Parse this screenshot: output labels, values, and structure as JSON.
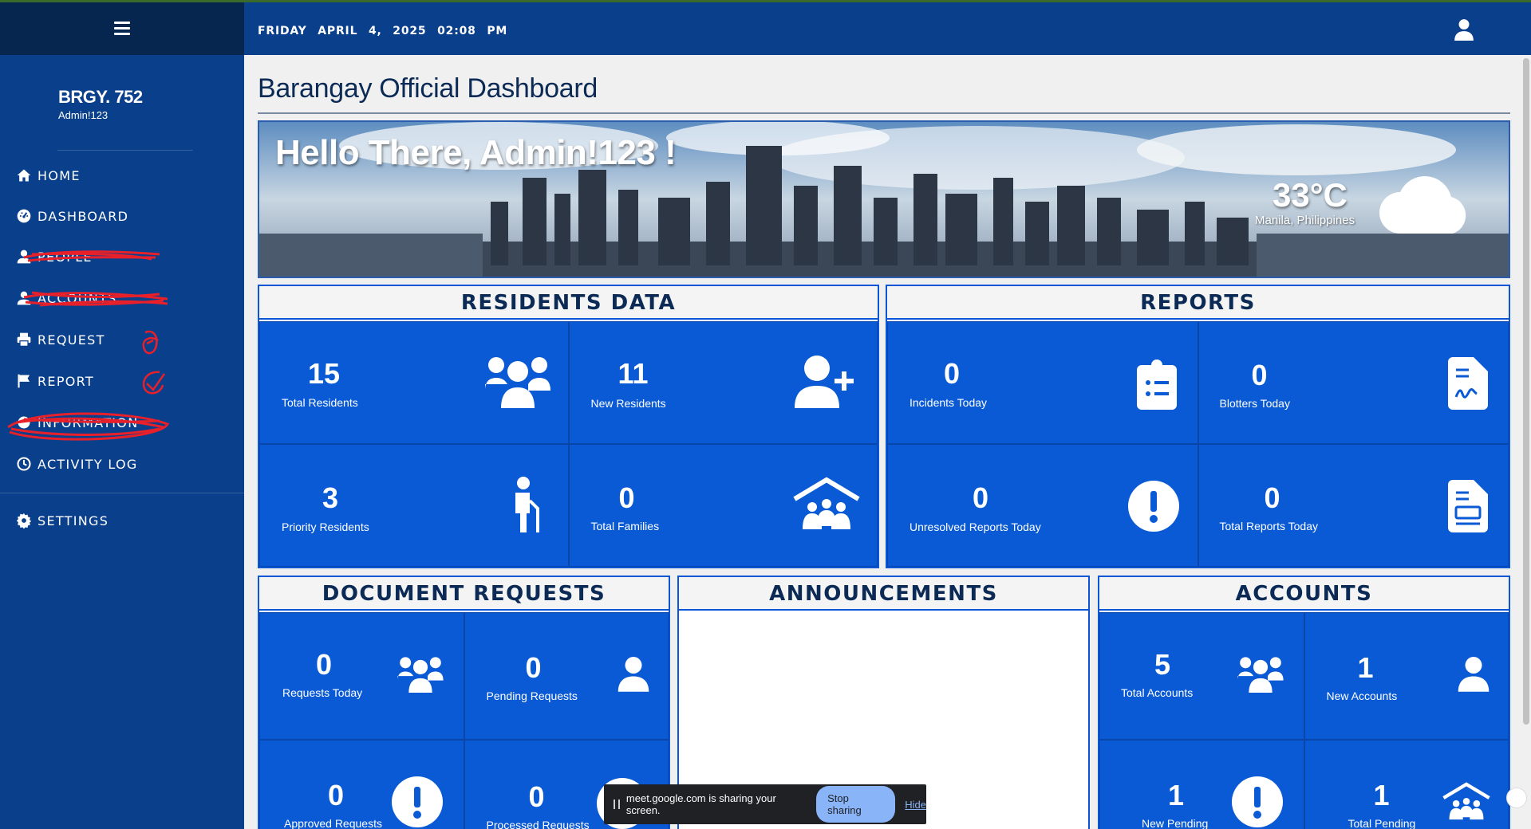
{
  "header": {
    "date": "FRIDAY  APRIL 4, 2025  02:08 PM"
  },
  "sidebar": {
    "brgy": "BRGY. 752",
    "user": "Admin!123",
    "items": [
      {
        "label": "HOME",
        "icon": "home-icon"
      },
      {
        "label": "DASHBOARD",
        "icon": "gauge-icon"
      },
      {
        "label": "PEOPLE",
        "icon": "user-icon"
      },
      {
        "label": "ACCOUNTS",
        "icon": "user-icon"
      },
      {
        "label": "REQUEST",
        "icon": "printer-icon"
      },
      {
        "label": "REPORT",
        "icon": "flag-icon"
      },
      {
        "label": "INFORMATION",
        "icon": "info-icon"
      },
      {
        "label": "ACTIVITY LOG",
        "icon": "clock-icon"
      },
      {
        "label": "SETTINGS",
        "icon": "gear-icon"
      }
    ]
  },
  "page": {
    "title": "Barangay Official Dashboard"
  },
  "banner": {
    "greeting": "Hello There, Admin!123 !",
    "temperature": "33°C",
    "location": "Manila, Philippines"
  },
  "residents": {
    "title": "RESIDENTS DATA",
    "tiles": [
      {
        "value": "15",
        "label": "Total Residents"
      },
      {
        "value": "11",
        "label": "New Residents"
      },
      {
        "value": "3",
        "label": "Priority Residents"
      },
      {
        "value": "0",
        "label": "Total Families"
      }
    ]
  },
  "reports": {
    "title": "REPORTS",
    "tiles": [
      {
        "value": "0",
        "label": "Incidents Today"
      },
      {
        "value": "0",
        "label": "Blotters Today"
      },
      {
        "value": "0",
        "label": "Unresolved Reports Today"
      },
      {
        "value": "0",
        "label": "Total Reports Today"
      }
    ]
  },
  "documents": {
    "title": "DOCUMENT REQUESTS",
    "tiles": [
      {
        "value": "0",
        "label": "Requests Today"
      },
      {
        "value": "0",
        "label": "Pending Requests"
      },
      {
        "value": "0",
        "label": "Approved Requests"
      },
      {
        "value": "0",
        "label": "Processed Requests"
      }
    ]
  },
  "announcements": {
    "title": "ANNOUNCEMENTS"
  },
  "accounts": {
    "title": "ACCOUNTS",
    "tiles": [
      {
        "value": "5",
        "label": "Total Accounts"
      },
      {
        "value": "1",
        "label": "New Accounts"
      },
      {
        "value": "1",
        "label": "New Pending"
      },
      {
        "value": "1",
        "label": "Total Pending"
      }
    ]
  },
  "share_popup": {
    "text": "meet.google.com is sharing your screen.",
    "stop": "Stop sharing",
    "hide": "Hide"
  }
}
